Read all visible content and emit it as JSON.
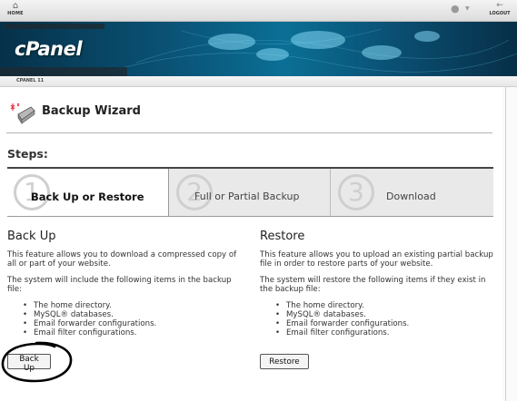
{
  "topbar": {
    "home_label": "HOME",
    "logout_label": "LOGOUT"
  },
  "banner": {
    "logo": "cPanel",
    "version": "CPANEL 11"
  },
  "page": {
    "title": "Backup Wizard",
    "steps_label": "Steps:"
  },
  "steps": [
    {
      "number": "1",
      "label": "Back Up or Restore",
      "active": true
    },
    {
      "number": "2",
      "label": "Full or Partial Backup",
      "active": false
    },
    {
      "number": "3",
      "label": "Download",
      "active": false
    }
  ],
  "backup": {
    "heading": "Back Up",
    "description": "This feature allows you to download a compressed copy of all or part of your website.",
    "intro": "The system will include the following items in the backup file:",
    "items": [
      "The home directory.",
      "MySQL® databases.",
      "Email forwarder configurations.",
      "Email filter configurations."
    ],
    "button": "Back Up"
  },
  "restore": {
    "heading": "Restore",
    "description": "This feature allows you to upload an existing partial backup file in order to restore parts of your website.",
    "intro": "The system will restore the following items if they exist in the backup file:",
    "items": [
      "The home directory.",
      "MySQL® databases.",
      "Email forwarder configurations.",
      "Email filter configurations."
    ],
    "button": "Restore"
  },
  "colors": {
    "banner_dark": "#06314a",
    "banner_light": "#0b6f95",
    "annotation": "#000000"
  },
  "icons": [
    "home-icon",
    "user-icon",
    "logout-icon",
    "backup-wizard-icon"
  ]
}
